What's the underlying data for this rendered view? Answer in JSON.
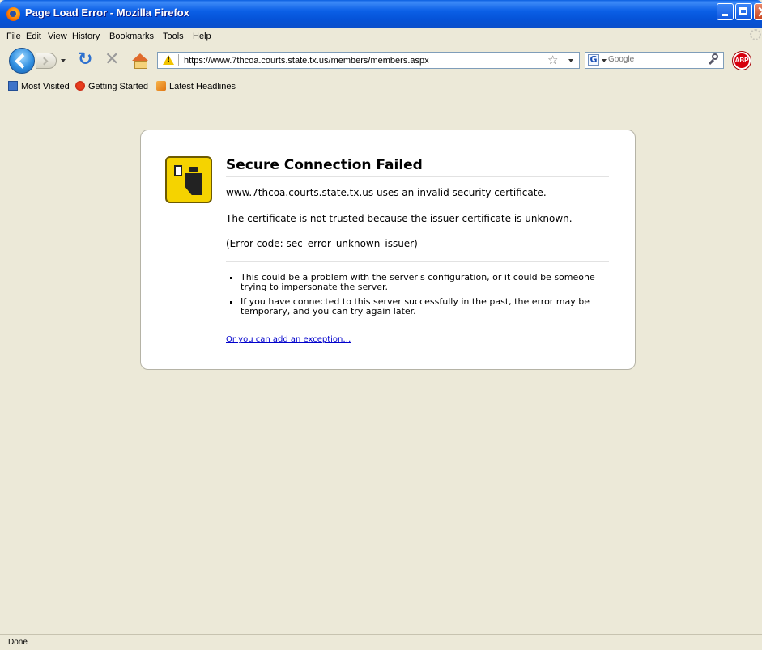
{
  "window": {
    "title": "Page Load Error - Mozilla Firefox"
  },
  "menu": [
    "File",
    "Edit",
    "View",
    "History",
    "Bookmarks",
    "Tools",
    "Help"
  ],
  "navigation": {
    "url": "https://www.7thcoa.courts.state.tx.us/members/members.aspx",
    "search_placeholder": "Google",
    "adblock_label": "ABP"
  },
  "bookmarks": [
    "Most Visited",
    "Getting Started",
    "Latest Headlines"
  ],
  "error": {
    "title": "Secure Connection Failed",
    "line1": "www.7thcoa.courts.state.tx.us uses an invalid security certificate.",
    "line2": "The certificate is not trusted because the issuer certificate is unknown.",
    "line3": "(Error code: sec_error_unknown_issuer)",
    "bullets": [
      "This could be a problem with the server's configuration, or it could be someone trying to impersonate the server.",
      "If you have connected to this server successfully in the past, the error may be temporary, and you can try again later."
    ],
    "exception_link": "Or you can add an exception…"
  },
  "status": "Done",
  "colors": {
    "titlebar": "#0553d8",
    "chrome": "#ece9d8",
    "link": "#0000cc",
    "cert_icon": "#f5d300"
  }
}
